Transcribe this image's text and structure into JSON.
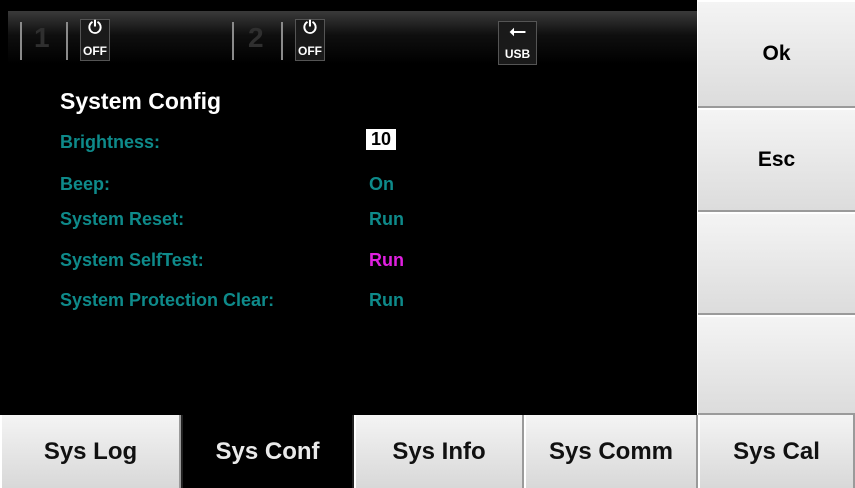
{
  "status": {
    "ch1_number": "1",
    "ch1_power_symbol": "⏻",
    "ch1_state": "OFF",
    "ch2_number": "2",
    "ch2_power_symbol": "⏻",
    "ch2_state": "OFF",
    "usb_symbol": "⭠",
    "usb_label": "USB"
  },
  "main": {
    "title": "System Config",
    "rows": [
      {
        "label": "Brightness:",
        "value": "10"
      },
      {
        "label": "Beep:",
        "value": "On"
      },
      {
        "label": "System Reset:",
        "value": "Run"
      },
      {
        "label": "System SelfTest:",
        "value": "Run"
      },
      {
        "label": "System Protection Clear:",
        "value": "Run"
      }
    ]
  },
  "softkeys": {
    "ok": "Ok",
    "esc": "Esc",
    "blank1": "",
    "blank2": ""
  },
  "tabs": [
    "Sys Log",
    "Sys Conf",
    "Sys Info",
    "Sys Comm",
    "Sys Cal"
  ],
  "colors": {
    "label": "#0e8a8a",
    "highlight": "#e020e0",
    "background": "#000000"
  }
}
